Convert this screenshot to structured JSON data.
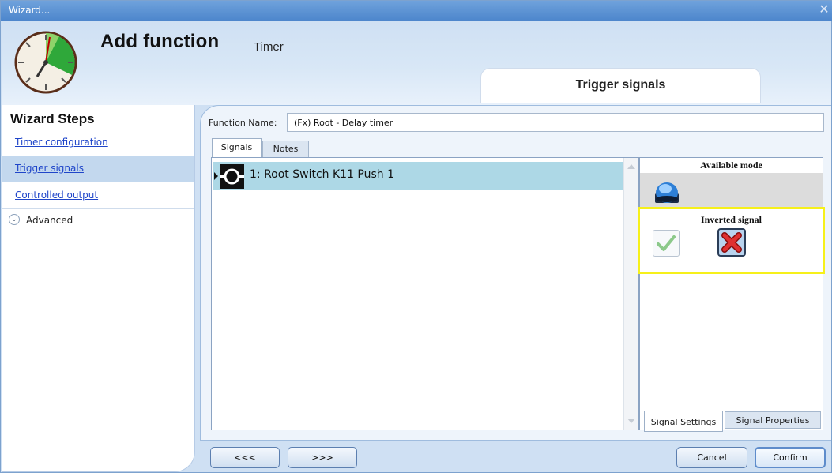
{
  "window": {
    "title": "Wizard...",
    "close_glyph": "✕"
  },
  "header": {
    "title": "Add function",
    "subtitle": "Timer",
    "current_step": "Trigger signals",
    "icon": "timer-clock-icon"
  },
  "sidebar": {
    "heading": "Wizard Steps",
    "items": [
      {
        "label": "Timer configuration",
        "active": false
      },
      {
        "label": "Trigger signals",
        "active": true
      },
      {
        "label": "Controlled output",
        "active": false
      }
    ],
    "advanced": {
      "label": "Advanced",
      "expand_glyph": "⌄"
    }
  },
  "main": {
    "function_name_label": "Function Name:",
    "function_name_value": "(Fx) Root - Delay timer",
    "tabs": [
      {
        "label": "Signals",
        "selected": true
      },
      {
        "label": "Notes",
        "selected": false
      }
    ],
    "signals": [
      {
        "label": "1: Root Switch K11 Push 1",
        "selected": true,
        "icon": "push-button-signal-icon"
      }
    ]
  },
  "settings_panel": {
    "available_mode_heading": "Available mode",
    "available_mode_icon": "blue-pushbutton-icon",
    "inverted_signal_heading": "Inverted signal",
    "inverted_options": [
      {
        "icon": "green-check-icon",
        "selected": false
      },
      {
        "icon": "red-x-icon",
        "selected": true
      }
    ],
    "highlight_color": "#f6f01a",
    "tabs": [
      {
        "label": "Signal Settings",
        "selected": true
      },
      {
        "label": "Signal Properties",
        "selected": false
      }
    ]
  },
  "footer": {
    "prev_label": "<<<",
    "next_label": ">>>",
    "cancel_label": "Cancel",
    "confirm_label": "Confirm"
  }
}
